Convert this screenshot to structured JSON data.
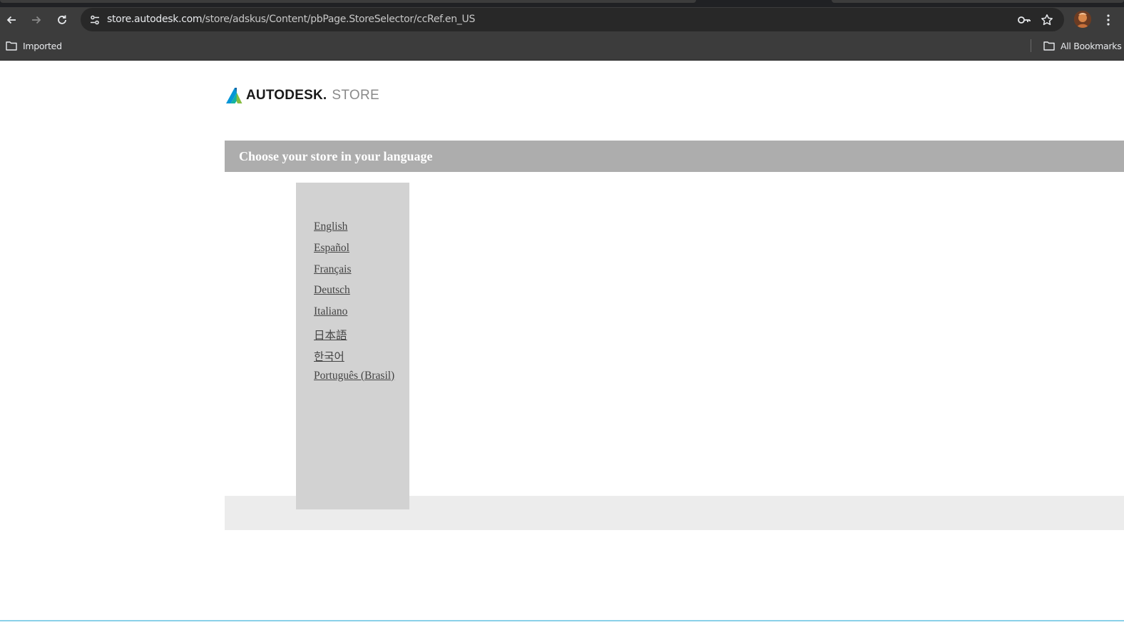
{
  "browser": {
    "url_host": "store.autodesk.com",
    "url_path": "/store/adskus/Content/pbPage.StoreSelector/ccRef.en_US",
    "bookmarks": {
      "left_folder": "Imported",
      "right_folder": "All Bookmarks"
    }
  },
  "page": {
    "logo": {
      "brand": "AUTODESK.",
      "suffix": "STORE"
    },
    "header_title": "Choose your store in your language",
    "languages": [
      "English",
      "Español",
      "Français",
      "Deutsch",
      "Italiano",
      "日本語",
      "한국어",
      "Português (Brasil)"
    ]
  },
  "colors": {
    "header_bar": "#adadad",
    "panel": "#d2d2d2",
    "footer_band": "#ececec",
    "chrome": "#3c3c3c",
    "logo_blue": "#0696d7",
    "logo_green": "#87bc40"
  }
}
